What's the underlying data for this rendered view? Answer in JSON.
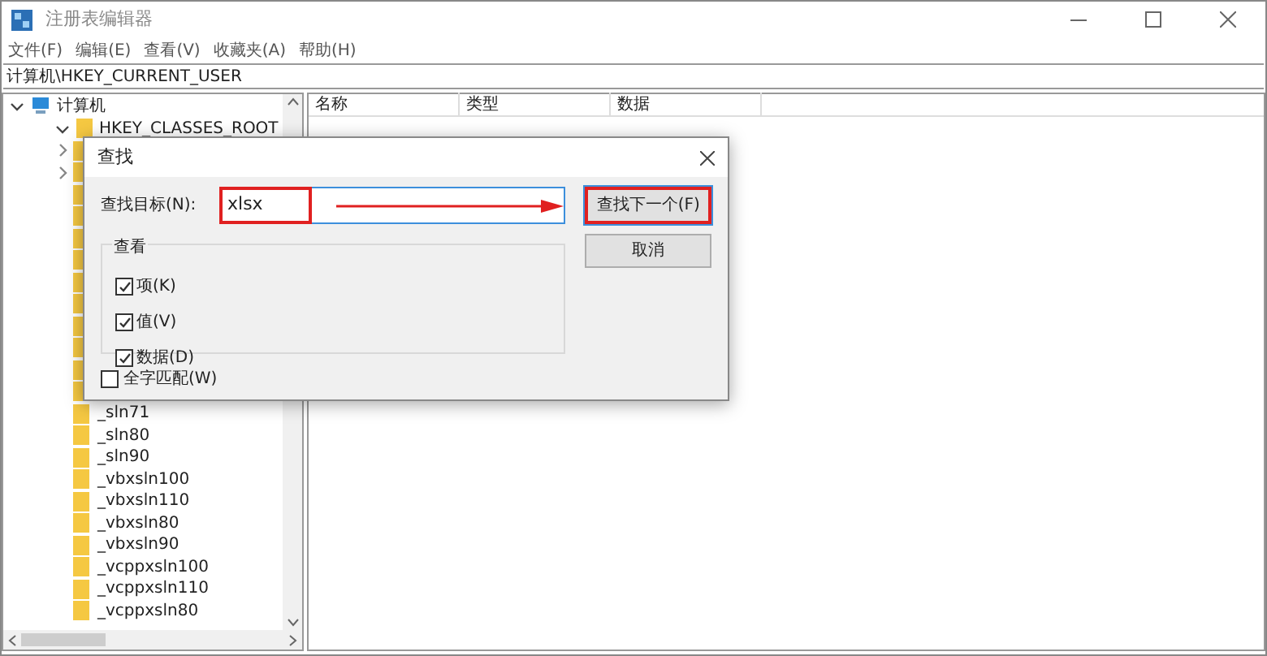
{
  "window": {
    "title": "注册表编辑器"
  },
  "menu": [
    "文件(F)",
    "编辑(E)",
    "查看(V)",
    "收藏夹(A)",
    "帮助(H)"
  ],
  "address": "计算机\\HKEY_CURRENT_USER",
  "tree": [
    {
      "label": "计算机",
      "expanded": true,
      "children": [
        {
          "label": "HKEY_CLASSES_ROOT",
          "expanded": true,
          "children": [
            {
              "label": "_sln71"
            },
            {
              "label": "_sln80"
            },
            {
              "label": "_sln90"
            },
            {
              "label": "_vbxsln100"
            },
            {
              "label": "_vbxsln110"
            },
            {
              "label": "_vbxsln80"
            },
            {
              "label": "_vbxsln90"
            },
            {
              "label": "_vcppxsln100"
            },
            {
              "label": "_vcppxsln110"
            },
            {
              "label": "_vcppxsln80"
            }
          ]
        }
      ]
    }
  ],
  "list": {
    "columns": [
      "名称",
      "类型",
      "数据"
    ]
  },
  "dialog": {
    "title": "查找",
    "find_label": "查找目标(N):",
    "find_value": "xlsx",
    "find_next": "查找下一个(F)",
    "cancel": "取消",
    "look_at": {
      "title": "查看",
      "options": [
        {
          "label": "项(K)",
          "checked": true
        },
        {
          "label": "值(V)",
          "checked": true
        },
        {
          "label": "数据(D)",
          "checked": true
        }
      ]
    },
    "match_whole": {
      "label": "全字匹配(W)",
      "checked": false
    }
  }
}
